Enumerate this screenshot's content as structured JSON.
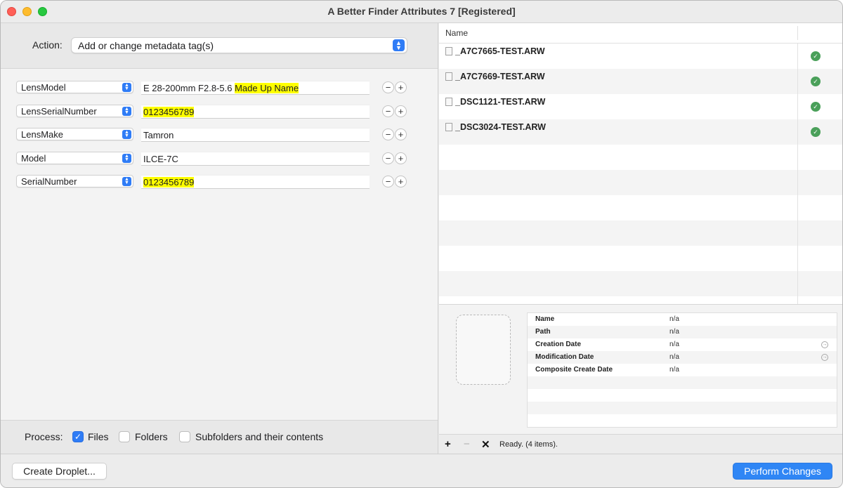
{
  "window": {
    "title": "A Better Finder Attributes 7 [Registered]"
  },
  "action": {
    "label": "Action:",
    "selected": "Add or change metadata tag(s)"
  },
  "tags": [
    {
      "field": "LensModel",
      "value_plain": "E 28-200mm F2.8-5.6 ",
      "value_highlight": "Made Up Name"
    },
    {
      "field": "LensSerialNumber",
      "value_plain": "",
      "value_highlight": "0123456789"
    },
    {
      "field": "LensMake",
      "value_plain": "Tamron",
      "value_highlight": ""
    },
    {
      "field": "Model",
      "value_plain": "ILCE-7C",
      "value_highlight": ""
    },
    {
      "field": "SerialNumber",
      "value_plain": "",
      "value_highlight": "0123456789"
    }
  ],
  "row_controls": {
    "minus": "−",
    "plus": "+"
  },
  "process": {
    "label": "Process:",
    "options": [
      {
        "label": "Files",
        "checked": true
      },
      {
        "label": "Folders",
        "checked": false
      },
      {
        "label": "Subfolders and their contents",
        "checked": false
      }
    ]
  },
  "file_list": {
    "column_name": "Name",
    "files": [
      {
        "name": "_A7C7665-TEST.ARW",
        "status": "ok"
      },
      {
        "name": "_A7C7669-TEST.ARW",
        "status": "ok"
      },
      {
        "name": "_DSC1121-TEST.ARW",
        "status": "ok"
      },
      {
        "name": "_DSC3024-TEST.ARW",
        "status": "ok"
      }
    ]
  },
  "info": [
    {
      "key": "Name",
      "value": "n/a",
      "has_go": false
    },
    {
      "key": "Path",
      "value": "n/a",
      "has_go": false
    },
    {
      "key": "Creation Date",
      "value": "n/a",
      "has_go": true
    },
    {
      "key": "Modification Date",
      "value": "n/a",
      "has_go": true
    },
    {
      "key": "Composite Create Date",
      "value": "n/a",
      "has_go": false
    }
  ],
  "status_bar": {
    "add": "+",
    "remove": "−",
    "clear": "✕",
    "text": "Ready. (4 items)."
  },
  "buttons": {
    "create_droplet": "Create Droplet...",
    "perform_changes": "Perform Changes"
  },
  "colors": {
    "accent": "#2f86f5",
    "highlight": "#ffff00",
    "ok": "#4aa05a"
  }
}
